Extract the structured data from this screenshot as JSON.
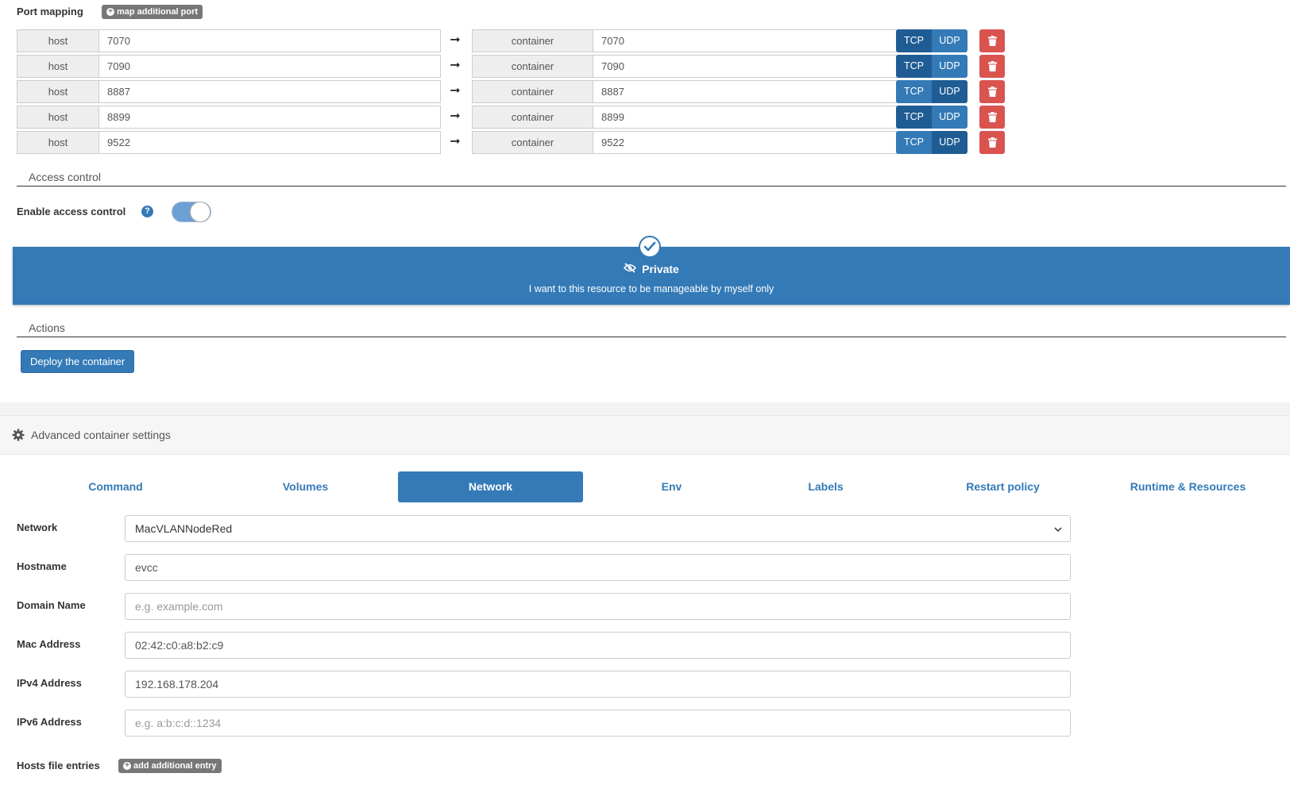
{
  "port_mapping": {
    "title": "Port mapping",
    "add_label": "map additional port",
    "rows": [
      {
        "host_label": "host",
        "host": "7070",
        "container_label": "container",
        "container": "7070",
        "tcp": "TCP",
        "udp": "UDP",
        "selected": "tcp"
      },
      {
        "host_label": "host",
        "host": "7090",
        "container_label": "container",
        "container": "7090",
        "tcp": "TCP",
        "udp": "UDP",
        "selected": "tcp"
      },
      {
        "host_label": "host",
        "host": "8887",
        "container_label": "container",
        "container": "8887",
        "tcp": "TCP",
        "udp": "UDP",
        "selected": "udp"
      },
      {
        "host_label": "host",
        "host": "8899",
        "container_label": "container",
        "container": "8899",
        "tcp": "TCP",
        "udp": "UDP",
        "selected": "tcp"
      },
      {
        "host_label": "host",
        "host": "9522",
        "container_label": "container",
        "container": "9522",
        "tcp": "TCP",
        "udp": "UDP",
        "selected": "udp"
      }
    ],
    "arrow": "➞"
  },
  "access_control": {
    "title": "Access control",
    "enable_label": "Enable access control",
    "help": "?",
    "enabled": true,
    "private_title": "Private",
    "private_desc": "I want to this resource to be manageable by myself only"
  },
  "actions": {
    "title": "Actions",
    "deploy_label": "Deploy the container"
  },
  "advanced": {
    "title": "Advanced container settings",
    "tabs": [
      "Command",
      "Volumes",
      "Network",
      "Env",
      "Labels",
      "Restart policy",
      "Runtime & Resources"
    ],
    "active_tab": "Network"
  },
  "network_form": {
    "network_label": "Network",
    "network_value": "MacVLANNodeRed",
    "hostname_label": "Hostname",
    "hostname_value": "evcc",
    "domain_label": "Domain Name",
    "domain_placeholder": "e.g. example.com",
    "mac_label": "Mac Address",
    "mac_value": "02:42:c0:a8:b2:c9",
    "ipv4_label": "IPv4 Address",
    "ipv4_value": "192.168.178.204",
    "ipv6_label": "IPv6 Address",
    "ipv6_placeholder": "e.g. a:b:c:d::1234",
    "hosts_label": "Hosts file entries",
    "hosts_add_label": "add additional entry"
  },
  "colors": {
    "primary": "#337ab7",
    "primary_dark": "#1f5c94",
    "danger": "#d9534f",
    "badge": "#777777"
  }
}
